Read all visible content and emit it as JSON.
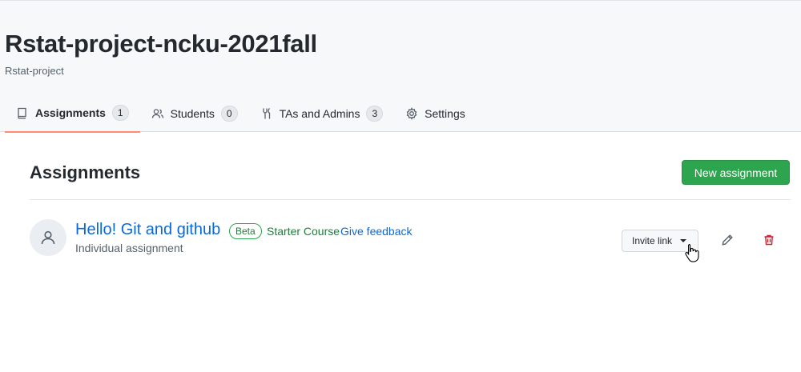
{
  "header": {
    "org_title": "Rstat-project-ncku-2021fall",
    "org_subtitle": "Rstat-project"
  },
  "tabs": [
    {
      "label": "Assignments",
      "count": "1",
      "icon": "book-icon",
      "selected": true
    },
    {
      "label": "Students",
      "count": "0",
      "icon": "people-icon",
      "selected": false
    },
    {
      "label": "TAs and Admins",
      "count": "3",
      "icon": "tools-icon",
      "selected": false
    },
    {
      "label": "Settings",
      "count": "",
      "icon": "gear-icon",
      "selected": false
    }
  ],
  "main": {
    "section_title": "Assignments",
    "new_assignment_label": "New assignment",
    "assignments": [
      {
        "title": "Hello! Git and github",
        "badge": "Beta",
        "starter_course": "Starter Course",
        "feedback_link": "Give feedback",
        "type": "Individual assignment",
        "invite_label": "Invite link"
      }
    ]
  },
  "colors": {
    "primary_green": "#2da44e",
    "link_blue": "#0969da",
    "tab_underline": "#fd8c73",
    "danger_red": "#cf222e"
  }
}
